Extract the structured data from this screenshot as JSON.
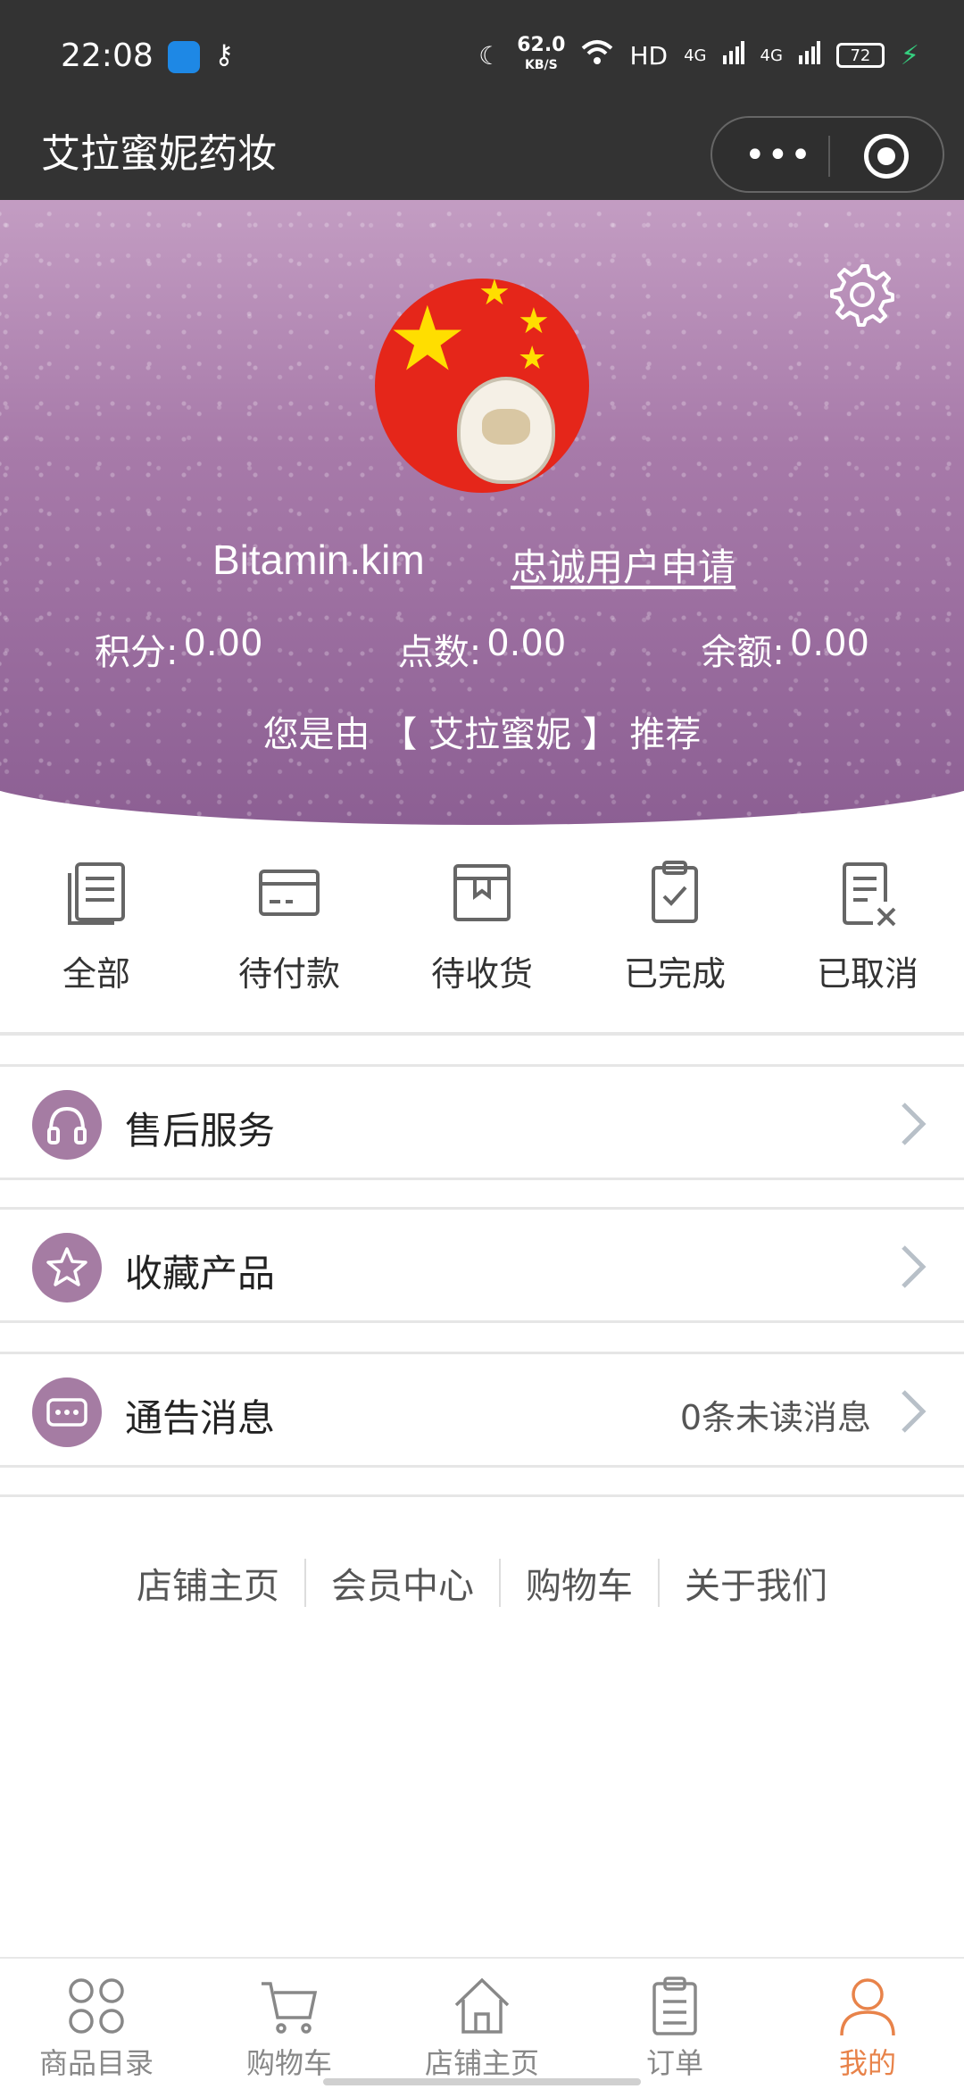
{
  "status_bar": {
    "time": "22:08",
    "net_speed": "62.0",
    "net_unit": "KB/S",
    "hd_label": "HD",
    "signal1": "4G",
    "signal2": "4G",
    "battery": "72"
  },
  "nav": {
    "title": "艾拉蜜妮药妆",
    "more_label": "•••"
  },
  "profile": {
    "username": "Bitamin.kim",
    "loyal_link": "忠诚用户申请",
    "stats": [
      {
        "label": "积分:",
        "value": "0.00"
      },
      {
        "label": "点数:",
        "value": "0.00"
      },
      {
        "label": "余额:",
        "value": "0.00"
      }
    ],
    "referral": "您是由 【 艾拉蜜妮 】 推荐"
  },
  "orders": [
    {
      "label": "全部",
      "icon": "all-orders-icon"
    },
    {
      "label": "待付款",
      "icon": "payment-card-icon"
    },
    {
      "label": "待收货",
      "icon": "package-box-icon"
    },
    {
      "label": "已完成",
      "icon": "clipboard-check-icon"
    },
    {
      "label": "已取消",
      "icon": "clipboard-cancel-icon"
    }
  ],
  "menu": [
    {
      "label": "售后服务",
      "icon": "headphones-icon",
      "extra": ""
    },
    {
      "label": "收藏产品",
      "icon": "star-icon",
      "extra": ""
    },
    {
      "label": "通告消息",
      "icon": "message-icon",
      "extra": "0条未读消息"
    }
  ],
  "footer_links": [
    "店铺主页",
    "会员中心",
    "购物车",
    "关于我们"
  ],
  "tabs": [
    {
      "label": "商品目录",
      "icon": "catalog-grid-icon",
      "active": false
    },
    {
      "label": "购物车",
      "icon": "cart-icon",
      "active": false
    },
    {
      "label": "店铺主页",
      "icon": "home-icon",
      "active": false
    },
    {
      "label": "订单",
      "icon": "order-list-icon",
      "active": false
    },
    {
      "label": "我的",
      "icon": "profile-person-icon",
      "active": true
    }
  ],
  "colors": {
    "accent": "#a57ca3",
    "active_tab": "#e8834a",
    "header_bar": "#333333"
  }
}
